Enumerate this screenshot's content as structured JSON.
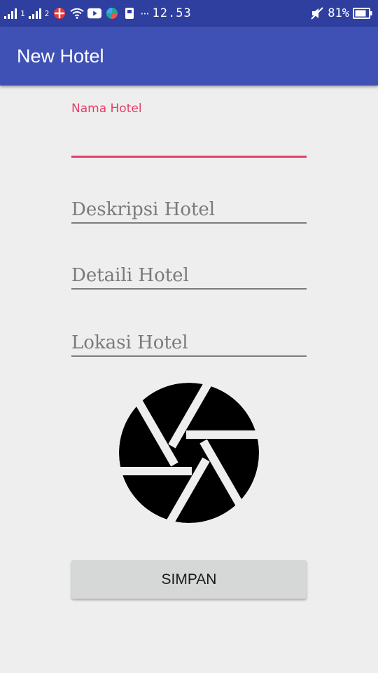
{
  "status_bar": {
    "sim1_label": "1",
    "sim2_label": "2",
    "overflow_dots": "···",
    "time": "12.53",
    "battery_percent": "81%"
  },
  "app_bar": {
    "title": "New Hotel"
  },
  "form": {
    "nama_hotel": {
      "label": "Nama Hotel",
      "value": ""
    },
    "deskripsi_hotel": {
      "placeholder": "Deskripsi Hotel",
      "value": ""
    },
    "detail_hotel": {
      "placeholder": "Detaili Hotel",
      "value": ""
    },
    "lokasi_hotel": {
      "placeholder": "Lokasi Hotel",
      "value": ""
    }
  },
  "image_picker": {
    "icon": "camera-shutter-icon"
  },
  "save_label": "SIMPAN",
  "colors": {
    "status_bar": "#2f3f9f",
    "app_bar": "#3f51b5",
    "accent": "#e63e6d",
    "background": "#eeeeee",
    "button": "#d6d7d7"
  }
}
